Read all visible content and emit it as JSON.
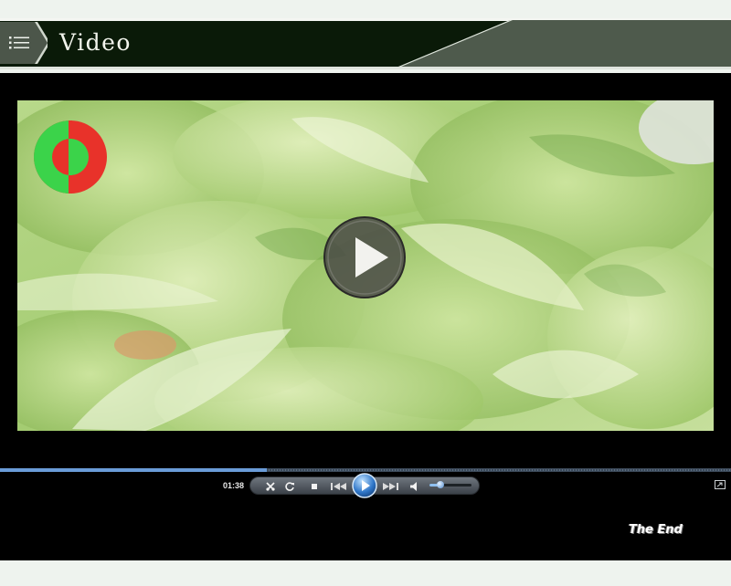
{
  "header": {
    "title": "Video",
    "menu_icon": "list-icon"
  },
  "video": {
    "play_icon": "play-icon",
    "logo_icon": "circular-logo-icon"
  },
  "player": {
    "current_time": "01:38",
    "progress": 0.365,
    "volume": 0.25,
    "controls": [
      "settings-icon",
      "refresh-icon",
      "stop-icon",
      "previous-icon",
      "play-icon",
      "next-icon",
      "volume-icon"
    ]
  },
  "end_label": "The End",
  "colors": {
    "header_bg": "#0a1a08",
    "stage_bg": "#000000",
    "page_bg": "#eef3ee",
    "progress_fill": "#6a9cd8",
    "logo_green": "#3bd34a",
    "logo_red": "#e8322a"
  }
}
